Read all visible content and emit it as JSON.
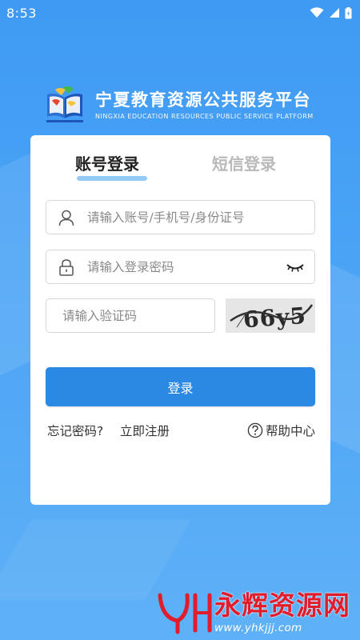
{
  "status_bar": {
    "time": "8:53"
  },
  "brand": {
    "title": "宁夏教育资源公共服务平台",
    "subtitle": "NINGXIA EDUCATION RESOURCES PUBLIC SERVICE PLATFORM"
  },
  "tabs": [
    {
      "label": "账号登录",
      "active": true
    },
    {
      "label": "短信登录",
      "active": false
    }
  ],
  "form": {
    "account_placeholder": "请输入账号/手机号/身份证号",
    "password_placeholder": "请输入登录密码",
    "captcha_placeholder": "请输入验证码",
    "captcha_text": "66y5",
    "login_label": "登录"
  },
  "links": {
    "forgot": "忘记密码?",
    "register": "立即注册",
    "help": "帮助中心"
  },
  "watermark": {
    "logo_text": "YH",
    "title": "永辉资源网",
    "url": "www.yhkjjj.com"
  },
  "colors": {
    "background": "#3f9af3",
    "primary_button": "#2b89e3",
    "tab_underline": "#7fc2f3",
    "watermark_red": "#e11d2b"
  },
  "icons": [
    "wifi-icon",
    "signal-icon",
    "battery-icon",
    "user-icon",
    "lock-icon",
    "eye-closed-icon",
    "help-circle-icon"
  ]
}
